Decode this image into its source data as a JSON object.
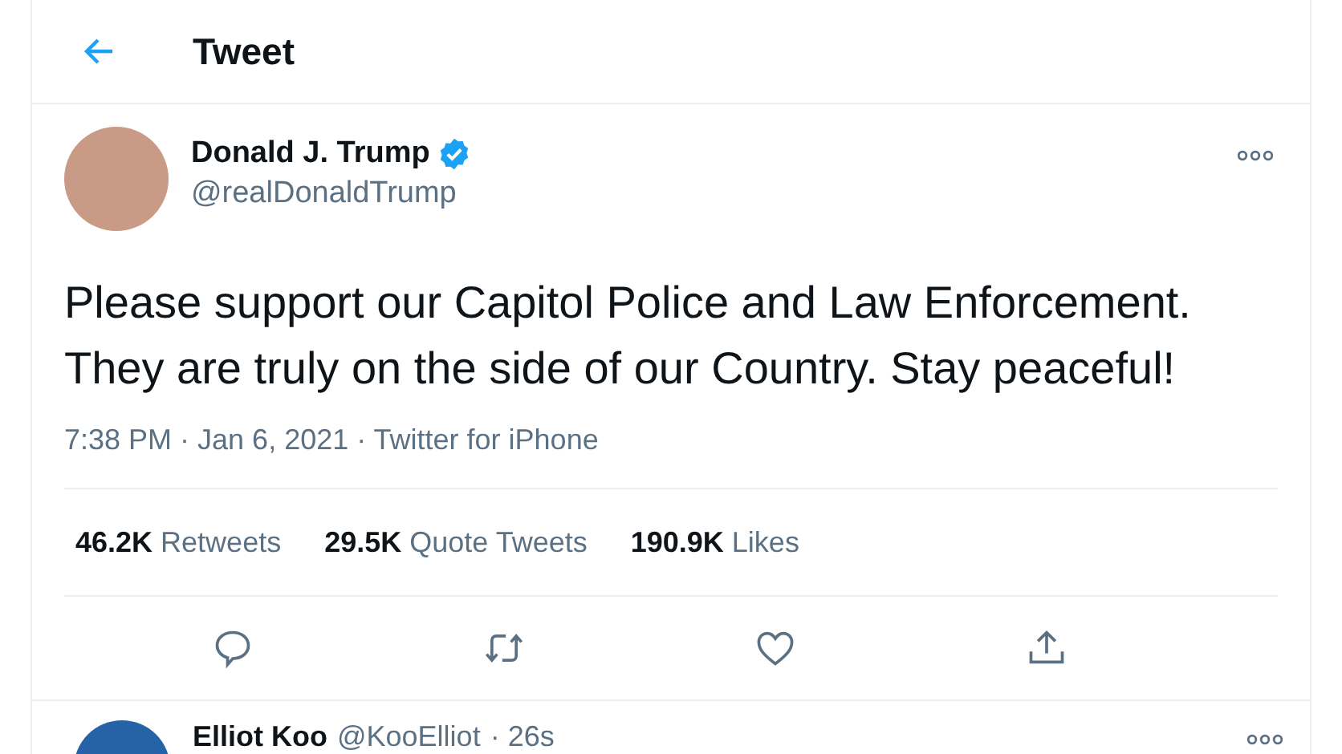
{
  "header": {
    "title": "Tweet"
  },
  "tweet": {
    "author": {
      "name": "Donald J. Trump",
      "verified": true,
      "handle": "@realDonaldTrump"
    },
    "text": "Please support our Capitol Police and Law Enforcement. They are truly on the side of our Country. Stay peaceful!",
    "meta": "7:38 PM · Jan 6, 2021 · Twitter for iPhone",
    "stats": [
      {
        "count": "46.2K",
        "label": "Retweets"
      },
      {
        "count": "29.5K",
        "label": "Quote Tweets"
      },
      {
        "count": "190.9K",
        "label": "Likes"
      }
    ],
    "actions": [
      {
        "kind": "reply"
      },
      {
        "kind": "retweet"
      },
      {
        "kind": "like"
      },
      {
        "kind": "share"
      }
    ]
  },
  "reply": {
    "name": "Elliot Koo",
    "handle": "@KooElliot",
    "time": "· 26s"
  }
}
